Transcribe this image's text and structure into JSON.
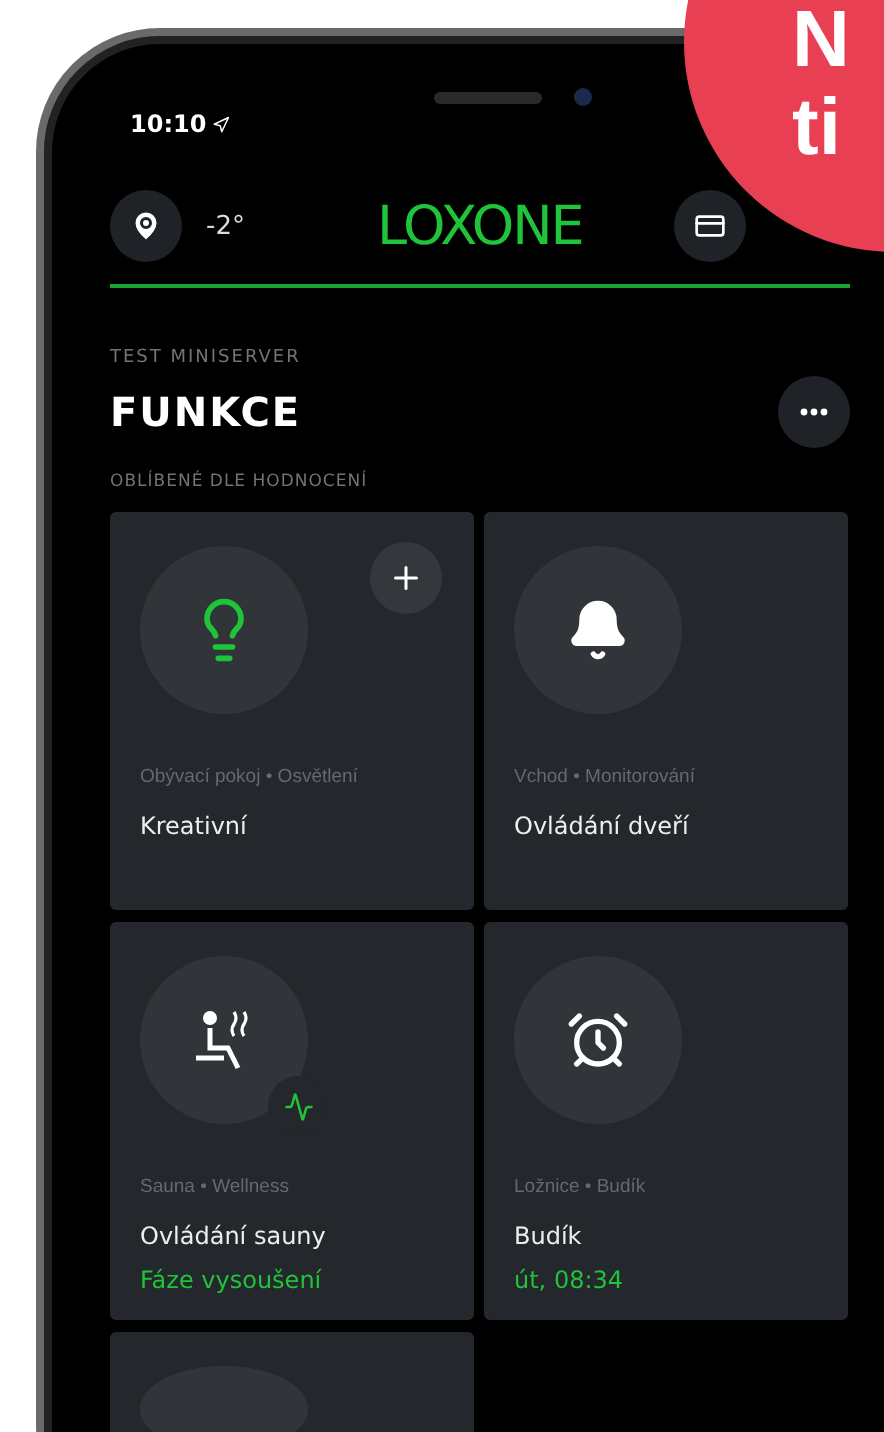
{
  "status_bar": {
    "time": "10:10"
  },
  "header": {
    "temperature": "-2°",
    "logo": "LOXONE"
  },
  "section": {
    "server": "TEST MINISERVER",
    "title": "FUNKCE",
    "subtitle": "OBLÍBENÉ DLE HODNOCENÍ"
  },
  "tiles": [
    {
      "kind": "light",
      "on": true,
      "location": "Obývací pokoj • Osvětlení",
      "title": "Kreativní"
    },
    {
      "kind": "bell",
      "on": false,
      "location": "Vchod • Monitorování",
      "title": "Ovládání dveří"
    },
    {
      "kind": "sauna",
      "on": false,
      "location": "Sauna • Wellness",
      "title": "Ovládání sauny",
      "status": "Fáze vysoušení"
    },
    {
      "kind": "alarm",
      "on": false,
      "location": "Ložnice • Budík",
      "title": "Budík",
      "status": "út, 08:34"
    },
    {
      "kind": "cut"
    }
  ],
  "badge": {
    "lines": [
      "N",
      "ti"
    ]
  }
}
